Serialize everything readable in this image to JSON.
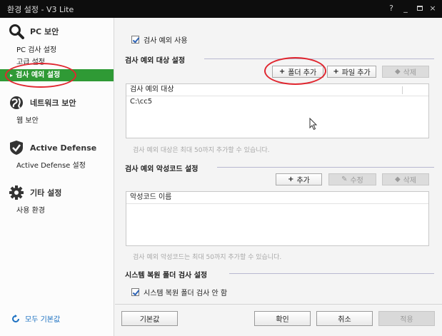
{
  "window": {
    "title": "환경 설정 - V3 Lite"
  },
  "titlebar": {
    "help": "?",
    "minimize": "_",
    "close": "×"
  },
  "sidebar": {
    "sections": [
      {
        "label": "PC 보안",
        "icon": "magnifier-icon",
        "items": [
          "PC 검사 설정",
          "고급 설정",
          "검사 예외 설정"
        ]
      },
      {
        "label": "네트워크 보안",
        "icon": "globe-icon",
        "items": [
          "웹 보안"
        ]
      },
      {
        "label": "Active Defense",
        "icon": "shield-check-icon",
        "items": [
          "Active Defense 설정"
        ]
      },
      {
        "label": "기타 설정",
        "icon": "gear-icon",
        "items": [
          "사용 환경"
        ]
      }
    ],
    "active_item": "검사 예외 설정",
    "reset_all": "모두 기본값"
  },
  "main": {
    "use_exclusion": "검사 예외 사용",
    "targets": {
      "title": "검사 예외 대상 설정",
      "add_folder": "폴더 추가",
      "add_file": "파일 추가",
      "delete": "삭제",
      "column": "검사 예외 대상",
      "rows": [
        "C:\\cc5"
      ],
      "hint": "검사 예외 대상은 최대 50까지 추가할 수 있습니다."
    },
    "malcode": {
      "title": "검사 예외 악성코드 설정",
      "add": "추가",
      "edit": "수정",
      "delete": "삭제",
      "column": "악성코드 이름",
      "hint": "검사 예외 악성코드는 최대 50까지 추가할 수 있습니다."
    },
    "restore": {
      "title": "시스템 복원 폴더 검사 설정",
      "skip": "시스템 복원 폴더 검사 안 함"
    }
  },
  "footer": {
    "default": "기본값",
    "ok": "확인",
    "cancel": "취소",
    "apply": "적용"
  }
}
